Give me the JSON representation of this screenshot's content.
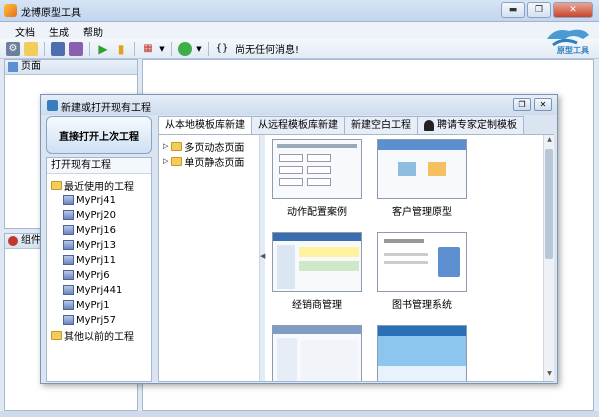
{
  "window": {
    "title": "龙博原型工具"
  },
  "menu": [
    "文档",
    "生成",
    "帮助"
  ],
  "toolbar": {
    "status": "尚无任何消息!"
  },
  "logo": {
    "text": "原型工具"
  },
  "panes": {
    "pages": "页面",
    "components": "组件"
  },
  "dialog": {
    "title": "新建或打开现有工程",
    "open_last": "直接打开上次工程",
    "open_existing": "打开现有工程",
    "tree": {
      "recent": "最近使用的工程",
      "projects": [
        "MyPrj41",
        "MyPrj20",
        "MyPrj16",
        "MyPrj13",
        "MyPrj11",
        "MyPrj6",
        "MyPrj441",
        "MyPrj1",
        "MyPrj57"
      ],
      "older": "其他以前的工程"
    },
    "tabs": [
      "从本地模板库新建",
      "从远程模板库新建",
      "新建空白工程",
      "聘请专家定制模板"
    ],
    "template_tree": [
      "多页动态页面",
      "单页静态页面"
    ],
    "cards": [
      "动作配置案例",
      "客户管理原型",
      "经销商管理",
      "图书管理系统",
      "",
      ""
    ]
  },
  "colors": {
    "accent": "#3a7cc0",
    "close": "#c8442b"
  }
}
